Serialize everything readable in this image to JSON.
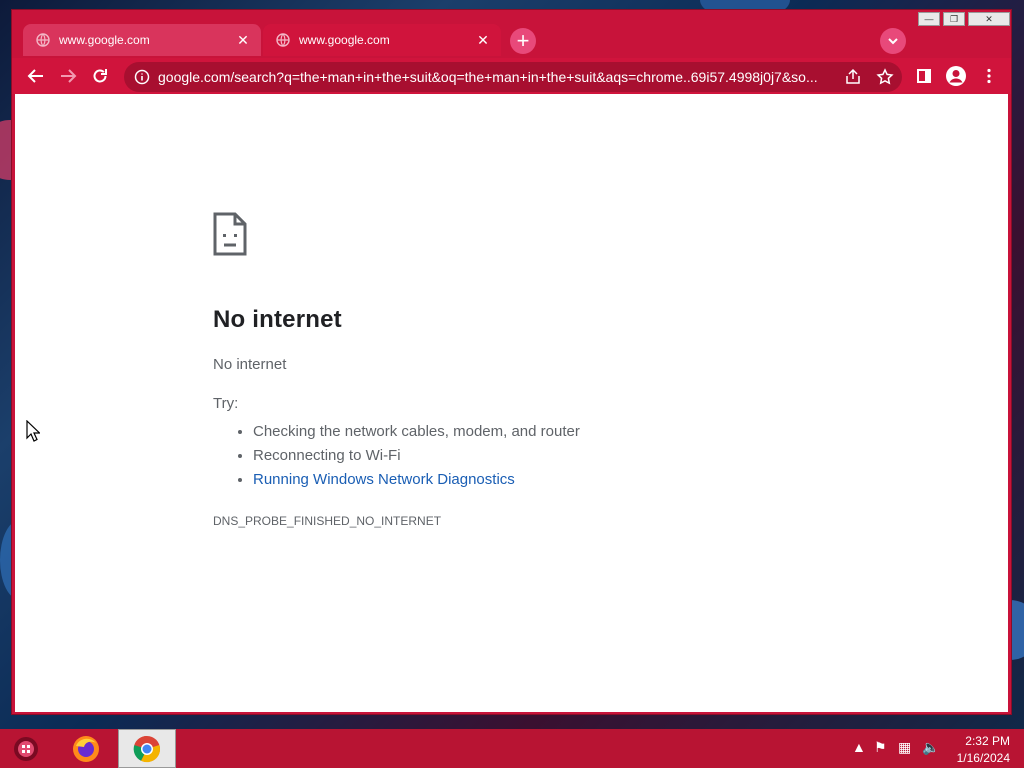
{
  "browser": {
    "tabs": [
      {
        "title": "www.google.com",
        "active": false
      },
      {
        "title": "www.google.com",
        "active": true
      }
    ],
    "window_controls": {
      "minimize": "—",
      "restore": "❐",
      "close": "✕"
    },
    "address_bar": {
      "url": "google.com/search?q=the+man+in+the+suit&oq=the+man+in+the+suit&aqs=chrome..69i57.4998j0j7&so..."
    }
  },
  "error_page": {
    "heading": "No internet",
    "subtitle": "No internet",
    "try_label": "Try:",
    "suggestions": [
      "Checking the network cables, modem, and router",
      "Reconnecting to Wi-Fi"
    ],
    "diagnostics_link": "Running Windows Network Diagnostics",
    "error_code": "DNS_PROBE_FINISHED_NO_INTERNET"
  },
  "taskbar": {
    "clock": {
      "time": "2:32 PM",
      "date": "1/16/2024"
    }
  },
  "colors": {
    "frame": "#c8133a",
    "toolbar": "#d0143c",
    "omnibox": "#a80f30",
    "link": "#1a5eb4",
    "taskbar": "#b81433"
  }
}
